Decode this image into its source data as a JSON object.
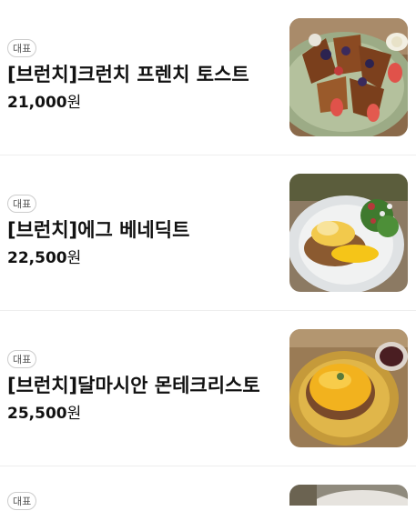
{
  "menu": {
    "items": [
      {
        "badge": "대표",
        "name": "[브런치]크런치 프렌치 토스트",
        "price": "21,000",
        "currency": "원",
        "photo": "french-toast-photo"
      },
      {
        "badge": "대표",
        "name": "[브런치]에그 베네딕트",
        "price": "22,500",
        "currency": "원",
        "photo": "eggs-benedict-photo"
      },
      {
        "badge": "대표",
        "name": "[브런치]달마시안 몬테크리스토",
        "price": "25,500",
        "currency": "원",
        "photo": "monte-cristo-photo"
      },
      {
        "badge": "대표",
        "name": "",
        "price": "",
        "currency": "",
        "photo": "partial-dish-photo"
      }
    ]
  }
}
